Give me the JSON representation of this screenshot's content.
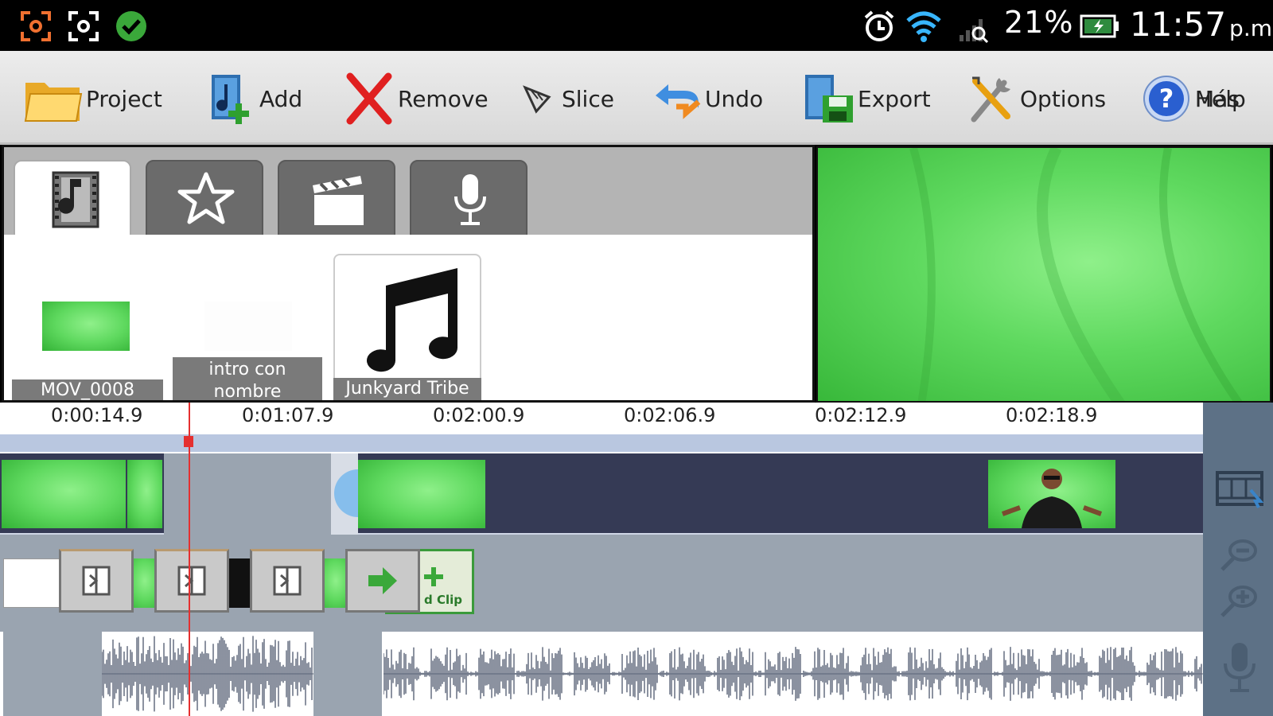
{
  "status_bar": {
    "left_icons": [
      "screenshot-icon",
      "camera-focus-icon",
      "check-circle-icon"
    ],
    "right_icons": [
      "alarm-icon",
      "wifi-icon",
      "signal-icon",
      "battery-charging-icon"
    ],
    "battery_percent": "21%",
    "time": "11:57",
    "time_suffix": "p.m."
  },
  "toolbar": {
    "buttons": [
      {
        "label": "Project",
        "icon": "folder-icon"
      },
      {
        "label": "Add",
        "icon": "add-media-icon"
      },
      {
        "label": "Remove",
        "icon": "remove-x-icon"
      },
      {
        "label": "Slice",
        "icon": "slice-icon"
      },
      {
        "label": "Undo",
        "icon": "undo-icon"
      },
      {
        "label": "Export",
        "icon": "export-icon"
      },
      {
        "label": "Options",
        "icon": "tools-icon"
      },
      {
        "label": "Help",
        "icon": "help-icon"
      }
    ],
    "overlapping_label": "Más"
  },
  "media_tabs": [
    {
      "icon": "media-library-icon",
      "active": true
    },
    {
      "icon": "star-icon",
      "active": false
    },
    {
      "icon": "clapperboard-icon",
      "active": false
    },
    {
      "icon": "microphone-icon",
      "active": false
    }
  ],
  "media_items": [
    {
      "caption": "MOV_0008",
      "kind": "video"
    },
    {
      "caption": "intro con nombre",
      "kind": "blank"
    },
    {
      "caption": "Junkyard Tribe",
      "kind": "audio"
    }
  ],
  "timeline": {
    "ticks": [
      "0:00:14.9",
      "0:01:07.9",
      "0:02:00.9",
      "0:02:06.9",
      "0:02:12.9",
      "0:02:18.9"
    ],
    "add_clip_label": "d Clip",
    "side_icons": [
      "filmstrip-icon",
      "zoom-out-icon",
      "zoom-in-icon",
      "microphone-icon"
    ]
  },
  "colors": {
    "toolbar_bg": "#e4e4e4",
    "video_track_bg": "#353a55",
    "transition_track_bg": "#9aa4b0",
    "side_panel_bg": "#5d7186",
    "playhead": "#e53030",
    "green_screen": "#5fd95f"
  }
}
